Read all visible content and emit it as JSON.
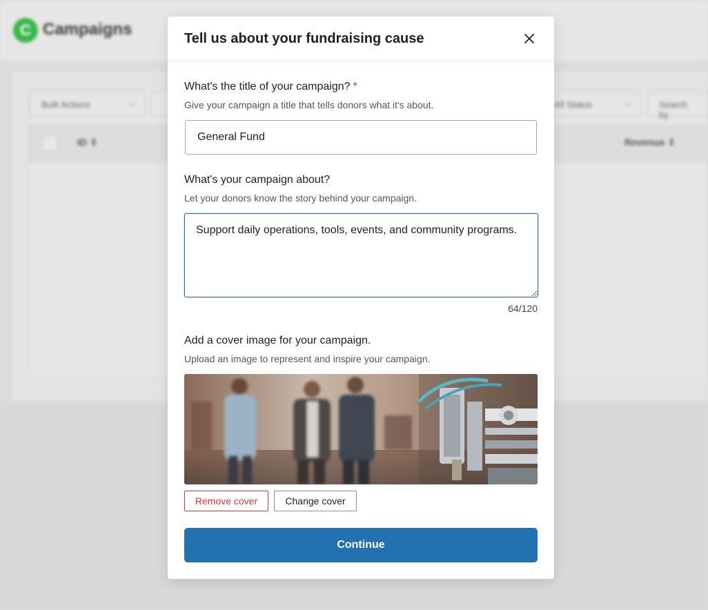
{
  "background": {
    "app_title": "Campaigns",
    "bulk_actions_label": "Bulk Actions",
    "status_filter_label": "All Status",
    "search_placeholder": "Search by",
    "column_id": "ID",
    "column_revenue": "Revenue"
  },
  "modal": {
    "title": "Tell us about your fundraising cause",
    "close_icon": "close-icon",
    "title_field": {
      "label": "What's the title of your campaign?",
      "required_mark": "*",
      "help": "Give your campaign a title that tells donors what it's about.",
      "value": "General Fund"
    },
    "description_field": {
      "label": "What's your campaign about?",
      "help": "Let your donors know the story behind your campaign.",
      "value": "Support daily operations, tools, events, and community programs.",
      "char_count": "64/120"
    },
    "cover_field": {
      "label": "Add a cover image for your campaign.",
      "help": "Upload an image to represent and inspire your campaign.",
      "remove_label": "Remove cover",
      "change_label": "Change cover"
    },
    "continue_label": "Continue"
  },
  "colors": {
    "accent": "#2271b1",
    "danger": "#d63638",
    "brand_green": "#3bb54a"
  }
}
